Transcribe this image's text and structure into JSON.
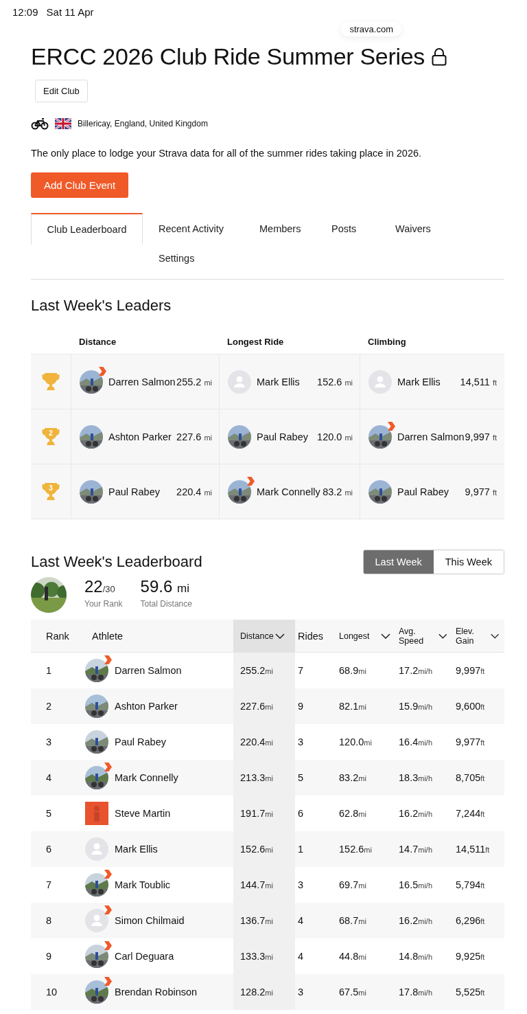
{
  "status_bar": {
    "time": "12:09",
    "date": "Sat 11 Apr"
  },
  "address_bar": {
    "url": "strava.com"
  },
  "club": {
    "title": "ERCC 2026 Club Ride Summer Series",
    "edit_button": "Edit Club",
    "location": "Billericay, England, United Kingdom",
    "description": "The only place to lodge your Strava data for all of the summer rides taking place in 2026.",
    "add_event_button": "Add Club Event"
  },
  "tabs": [
    {
      "label": "Club Leaderboard",
      "selected": true
    },
    {
      "label": "Recent Activity",
      "selected": false
    },
    {
      "label": "Members",
      "selected": false
    },
    {
      "label": "Posts",
      "selected": false
    },
    {
      "label": "Waivers",
      "selected": false
    },
    {
      "label": "Settings",
      "selected": false
    }
  ],
  "leaders": {
    "title": "Last Week's Leaders",
    "columns": [
      "Distance",
      "Longest Ride",
      "Climbing"
    ],
    "rows": [
      {
        "place": "",
        "entries": [
          {
            "name": "Darren Salmon",
            "value": "255.2",
            "unit": "mi",
            "badge": true
          },
          {
            "name": "Mark Ellis",
            "value": "152.6",
            "unit": "mi",
            "kind": "default",
            "badge": false
          },
          {
            "name": "Mark Ellis",
            "value": "14,511",
            "unit": "ft",
            "kind": "default",
            "badge": false
          }
        ]
      },
      {
        "place": "2",
        "entries": [
          {
            "name": "Ashton Parker",
            "value": "227.6",
            "unit": "mi",
            "badge": false
          },
          {
            "name": "Paul Rabey",
            "value": "120.0",
            "unit": "mi",
            "badge": false
          },
          {
            "name": "Darren Salmon",
            "value": "9,997",
            "unit": "ft",
            "badge": true
          }
        ]
      },
      {
        "place": "3",
        "entries": [
          {
            "name": "Paul Rabey",
            "value": "220.4",
            "unit": "mi",
            "badge": false
          },
          {
            "name": "Mark Connelly",
            "value": "83.2",
            "unit": "mi",
            "badge": true
          },
          {
            "name": "Paul Rabey",
            "value": "9,977",
            "unit": "ft",
            "badge": false
          }
        ]
      }
    ]
  },
  "leaderboard": {
    "title": "Last Week's Leaderboard",
    "periods": [
      {
        "label": "Last Week",
        "selected": true
      },
      {
        "label": "This Week",
        "selected": false
      }
    ],
    "me": {
      "rank": "22",
      "of": "/30",
      "rank_label": "Your Rank",
      "distance": "59.6",
      "unit": "mi",
      "distance_label": "Total Distance"
    },
    "columns": [
      {
        "label": "Rank",
        "sortable": false,
        "sorted": false
      },
      {
        "label": "Athlete",
        "sortable": false,
        "sorted": false
      },
      {
        "label": "Distance",
        "sortable": true,
        "sorted": true
      },
      {
        "label": "Rides",
        "sortable": false,
        "sorted": false
      },
      {
        "label": "Longest",
        "sortable": true,
        "sorted": false
      },
      {
        "label": "Avg. Speed",
        "sortable": true,
        "sorted": false
      },
      {
        "label": "Elev. Gain",
        "sortable": true,
        "sorted": false
      }
    ],
    "rows": [
      {
        "badge": true,
        "cells": [
          {
            "value": "1"
          },
          {
            "value": "Darren Salmon"
          },
          {
            "value": "255.2",
            "unit": "mi"
          },
          {
            "value": "7"
          },
          {
            "value": "68.9",
            "unit": "mi"
          },
          {
            "value": "17.2",
            "unit": "mi/h"
          },
          {
            "value": "9,997",
            "unit": "ft"
          }
        ]
      },
      {
        "badge": false,
        "cells": [
          {
            "value": "2"
          },
          {
            "value": "Ashton Parker"
          },
          {
            "value": "227.6",
            "unit": "mi"
          },
          {
            "value": "9"
          },
          {
            "value": "82.1",
            "unit": "mi"
          },
          {
            "value": "15.9",
            "unit": "mi/h"
          },
          {
            "value": "9,600",
            "unit": "ft"
          }
        ]
      },
      {
        "badge": false,
        "cells": [
          {
            "value": "3"
          },
          {
            "value": "Paul Rabey"
          },
          {
            "value": "220.4",
            "unit": "mi"
          },
          {
            "value": "3"
          },
          {
            "value": "120.0",
            "unit": "mi"
          },
          {
            "value": "16.4",
            "unit": "mi/h"
          },
          {
            "value": "9,977",
            "unit": "ft"
          }
        ]
      },
      {
        "badge": true,
        "cells": [
          {
            "value": "4"
          },
          {
            "value": "Mark Connelly"
          },
          {
            "value": "213.3",
            "unit": "mi"
          },
          {
            "value": "5"
          },
          {
            "value": "83.2",
            "unit": "mi"
          },
          {
            "value": "18.3",
            "unit": "mi/h"
          },
          {
            "value": "8,705",
            "unit": "ft"
          }
        ]
      },
      {
        "kind": "square",
        "badge": false,
        "cells": [
          {
            "value": "5"
          },
          {
            "value": "Steve Martin"
          },
          {
            "value": "191.7",
            "unit": "mi"
          },
          {
            "value": "6"
          },
          {
            "value": "62.8",
            "unit": "mi"
          },
          {
            "value": "16.2",
            "unit": "mi/h"
          },
          {
            "value": "7,244",
            "unit": "ft"
          }
        ]
      },
      {
        "kind": "default",
        "badge": false,
        "cells": [
          {
            "value": "6"
          },
          {
            "value": "Mark Ellis"
          },
          {
            "value": "152.6",
            "unit": "mi"
          },
          {
            "value": "1"
          },
          {
            "value": "152.6",
            "unit": "mi"
          },
          {
            "value": "14.7",
            "unit": "mi/h"
          },
          {
            "value": "14,511",
            "unit": "ft"
          }
        ]
      },
      {
        "badge": true,
        "cells": [
          {
            "value": "7"
          },
          {
            "value": "Mark Toublic"
          },
          {
            "value": "144.7",
            "unit": "mi"
          },
          {
            "value": "3"
          },
          {
            "value": "69.7",
            "unit": "mi"
          },
          {
            "value": "16.5",
            "unit": "mi/h"
          },
          {
            "value": "5,794",
            "unit": "ft"
          }
        ]
      },
      {
        "kind": "default",
        "badge": true,
        "cells": [
          {
            "value": "8"
          },
          {
            "value": "Simon Chilmaid"
          },
          {
            "value": "136.7",
            "unit": "mi"
          },
          {
            "value": "4"
          },
          {
            "value": "68.7",
            "unit": "mi"
          },
          {
            "value": "16.2",
            "unit": "mi/h"
          },
          {
            "value": "6,296",
            "unit": "ft"
          }
        ]
      },
      {
        "badge": true,
        "cells": [
          {
            "value": "9"
          },
          {
            "value": "Carl Deguara"
          },
          {
            "value": "133.3",
            "unit": "mi"
          },
          {
            "value": "4"
          },
          {
            "value": "44.8",
            "unit": "mi"
          },
          {
            "value": "14.8",
            "unit": "mi/h"
          },
          {
            "value": "9,925",
            "unit": "ft"
          }
        ]
      },
      {
        "badge": true,
        "cells": [
          {
            "value": "10"
          },
          {
            "value": "Brendan Robinson"
          },
          {
            "value": "128.2",
            "unit": "mi"
          },
          {
            "value": "3"
          },
          {
            "value": "67.5",
            "unit": "mi"
          },
          {
            "value": "17.8",
            "unit": "mi/h"
          },
          {
            "value": "5,525",
            "unit": "ft"
          }
        ]
      }
    ]
  }
}
